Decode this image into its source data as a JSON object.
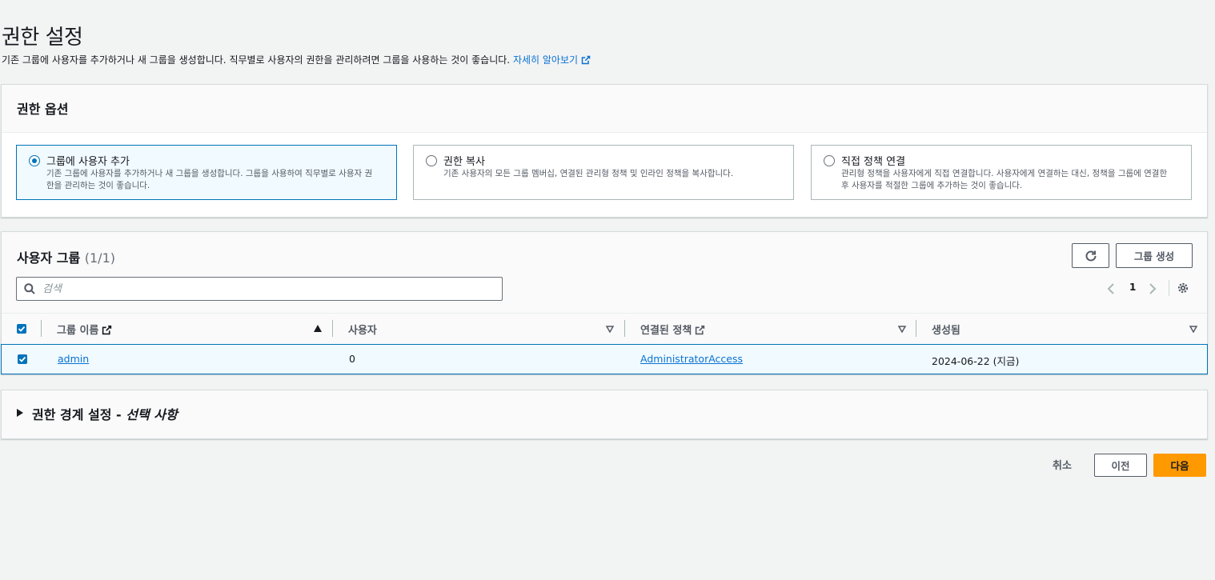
{
  "page": {
    "title": "권한 설정",
    "description": "기존 그룹에 사용자를 추가하거나 새 그룹을 생성합니다. 직무별로 사용자의 권한을 관리하려면 그룹을 사용하는 것이 좋습니다.",
    "learn_more": "자세히 알아보기"
  },
  "options": {
    "title": "권한 옵션",
    "items": [
      {
        "label": "그룹에 사용자 추가",
        "desc": "기존 그룹에 사용자를 추가하거나 새 그룹을 생성합니다. 그룹을 사용하여 직무별로 사용자 권한을 관리하는 것이 좋습니다.",
        "selected": true
      },
      {
        "label": "권한 복사",
        "desc": "기존 사용자의 모든 그룹 멤버십, 연결된 관리형 정책 및 인라인 정책을 복사합니다.",
        "selected": false
      },
      {
        "label": "직접 정책 연결",
        "desc": "관리형 정책을 사용자에게 직접 연결합니다. 사용자에게 연결하는 대신, 정책을 그룹에 연결한 후 사용자를 적절한 그룹에 추가하는 것이 좋습니다.",
        "selected": false
      }
    ]
  },
  "groups": {
    "title": "사용자 그룹",
    "count": "(1/1)",
    "create_label": "그룹 생성",
    "search_placeholder": "검색",
    "page_number": "1",
    "columns": {
      "name": "그룹 이름",
      "users": "사용자",
      "policies": "연결된 정책",
      "created": "생성됨"
    },
    "rows": [
      {
        "name": "admin",
        "users": "0",
        "policy": "AdministratorAccess",
        "created": "2024-06-22 (지금)",
        "checked": true
      }
    ]
  },
  "boundary": {
    "title": "권한 경계 설정 - ",
    "optional": "선택 사항"
  },
  "footer": {
    "cancel": "취소",
    "previous": "이전",
    "next": "다음"
  },
  "colors": {
    "accent": "#0073bb",
    "primary_button": "#ff9900",
    "link": "#0972d3"
  }
}
